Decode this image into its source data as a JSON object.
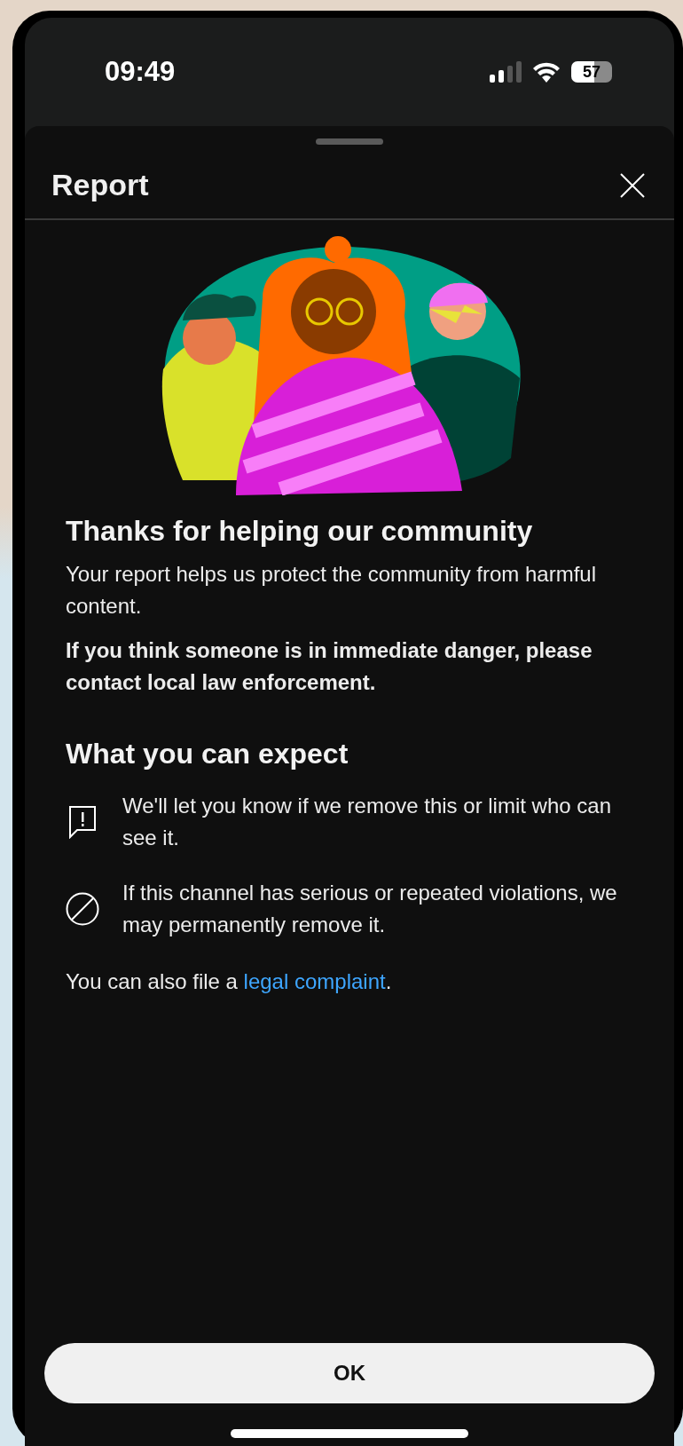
{
  "status_bar": {
    "time": "09:49",
    "battery": "57"
  },
  "sheet": {
    "title": "Report"
  },
  "heading": "Thanks for helping our community",
  "intro": "Your report helps us protect the community from harmful content.",
  "warning": "If you think someone is in immediate danger, please contact local law enforcement.",
  "expect": {
    "heading": "What you can expect",
    "items": [
      {
        "kind": "notice",
        "text": "We'll let you know if we remove this or limit who can see it."
      },
      {
        "kind": "block",
        "text": "If this channel has serious or repeated violations, we may permanently remove it."
      }
    ]
  },
  "footer": {
    "text": "You can also file a",
    "link": "legal complaint",
    "end": "."
  },
  "button": "OK"
}
